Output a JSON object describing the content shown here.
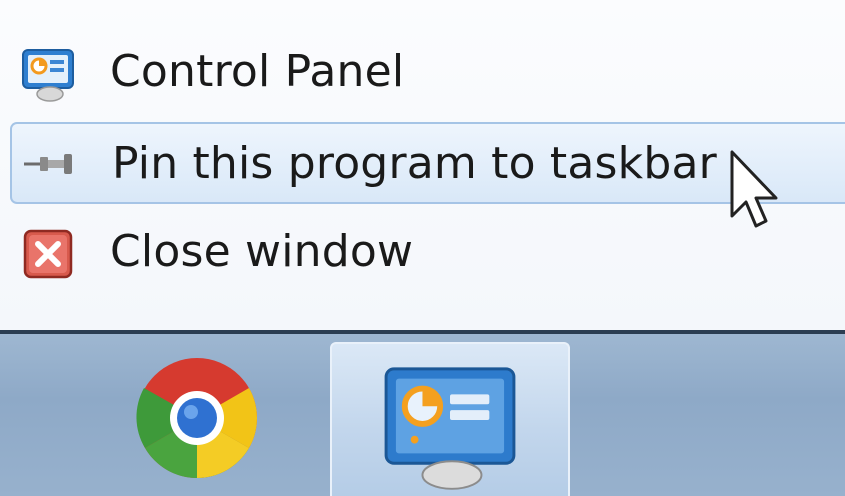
{
  "jumplist": {
    "items": [
      {
        "label": "Control Panel",
        "icon": "control-panel-icon"
      },
      {
        "label": "Pin this program to taskbar",
        "icon": "pin-icon"
      },
      {
        "label": "Close window",
        "icon": "close-window-icon"
      }
    ]
  },
  "taskbar": {
    "buttons": [
      {
        "icon": "chrome-icon"
      },
      {
        "icon": "control-panel-icon",
        "active": true
      }
    ]
  },
  "colors": {
    "hover_border": "#a5c4e6",
    "hover_fill": "#d9e8f8",
    "taskbar": "#97b1cd",
    "close_red": "#c94a3f"
  }
}
